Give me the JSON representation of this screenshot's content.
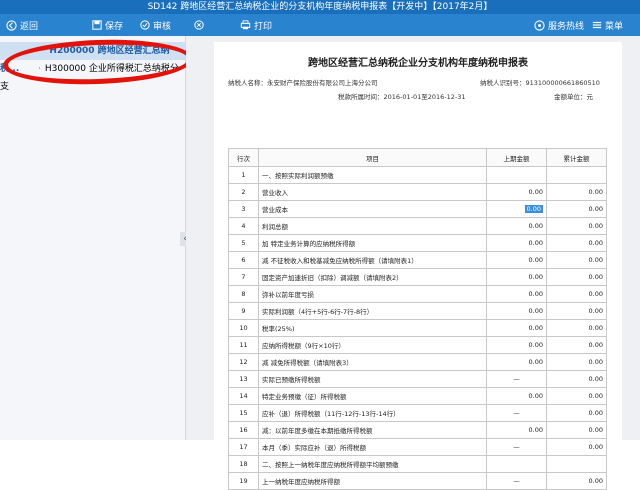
{
  "window": {
    "title": "SD142 跨地区经营汇总纳税企业的分支机构年度纳税申报表【开发中】【2017年2月】"
  },
  "toolbar": {
    "back": "返回",
    "save": "保存",
    "audit": "审核",
    "print": "打印",
    "service": "服务热线",
    "menu": "菜单"
  },
  "sidebar": {
    "items": [
      {
        "code": "H200000",
        "label": "跨地区经营汇总纳税..."
      },
      {
        "code": "H300000",
        "label": "企业所得税汇总纳税分支"
      }
    ]
  },
  "form": {
    "title": "跨地区经营汇总纳税企业分支机构年度纳税申报表",
    "taxpayer_name": "纳税人名称：永安财产保险股份有限公司上海分公司",
    "taxpayer_id": "纳税人识别号：913100000661860510",
    "period": "税款所属时间：2016-01-01至2016-12-31",
    "unit": "金额单位：元",
    "columns": {
      "index": "行次",
      "item": "项目",
      "branch_amount": "上期金额",
      "cumulative": "累计金额"
    },
    "rows": [
      {
        "no": "1",
        "item": "一、按照实际利润额预缴",
        "a": "",
        "b": ""
      },
      {
        "no": "2",
        "item": "营业收入",
        "a": "0.00",
        "b": "0.00"
      },
      {
        "no": "3",
        "item": "营业成本",
        "a": "0.00",
        "b": "0.00"
      },
      {
        "no": "4",
        "item": "利润总额",
        "a": "0.00",
        "b": "0.00"
      },
      {
        "no": "5",
        "item": "加 特定业务计算的应纳税所得额",
        "a": "0.00",
        "b": "0.00"
      },
      {
        "no": "6",
        "item": "减 不征税收入和税基减免应纳税所得额（请填附表1）",
        "a": "0.00",
        "b": "0.00"
      },
      {
        "no": "7",
        "item": "固定资产加速折旧（扣除）调减额（请填附表2）",
        "a": "0.00",
        "b": "0.00"
      },
      {
        "no": "8",
        "item": "弥补以前年度亏损",
        "a": "0.00",
        "b": "0.00"
      },
      {
        "no": "9",
        "item": "实际利润额（4行+5行-6行-7行-8行）",
        "a": "0.00",
        "b": "0.00"
      },
      {
        "no": "10",
        "item": "税率(25%)",
        "a": "0.00",
        "b": "0.00"
      },
      {
        "no": "11",
        "item": "应纳所得税额（9行×10行）",
        "a": "0.00",
        "b": "0.00"
      },
      {
        "no": "12",
        "item": "减 减免所得税额（请填附表3）",
        "a": "0.00",
        "b": "0.00"
      },
      {
        "no": "13",
        "item": "实际已预缴所得税额",
        "a": "—",
        "b": "0.00"
      },
      {
        "no": "14",
        "item": "特定业务预缴（征）所得税额",
        "a": "0.00",
        "b": "0.00"
      },
      {
        "no": "15",
        "item": "应补（退）所得税额（11行-12行-13行-14行）",
        "a": "—",
        "b": "0.00"
      },
      {
        "no": "16",
        "item": "减：以前年度多缴在本期抵缴所得税额",
        "a": "0.00",
        "b": "0.00"
      },
      {
        "no": "17",
        "item": "本月（季）实际应补（退）所得税额",
        "a": "—",
        "b": "0.00"
      },
      {
        "no": "18",
        "item": "二、按照上一纳税年度应纳税所得额平均额预缴",
        "a": "",
        "b": ""
      },
      {
        "no": "19",
        "item": "上一纳税年度应纳税所得额",
        "a": "—",
        "b": "0.00"
      }
    ]
  },
  "colors": {
    "titlebar": "#1a6fbd",
    "toolbar": "#2a83cf",
    "annotation": "#e3120b",
    "selection": "#3b8fe0"
  }
}
